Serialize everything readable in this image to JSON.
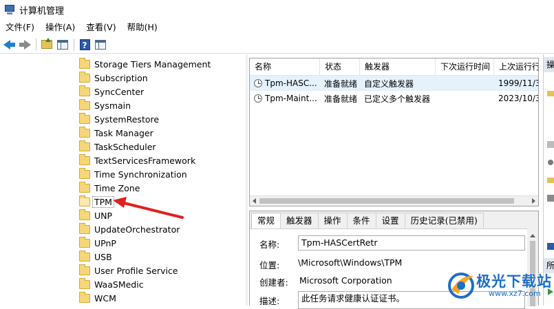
{
  "window": {
    "title": "计算机管理"
  },
  "menu": [
    "文件(F)",
    "操作(A)",
    "查看(V)",
    "帮助(H)"
  ],
  "toolbar": {
    "icons": [
      "back-arrow-icon",
      "forward-arrow-icon",
      "up-folder-icon",
      "show-hide-tree-icon",
      "help-icon",
      "action-pane-icon"
    ]
  },
  "tree": {
    "items": [
      {
        "label": "Storage Tiers Management"
      },
      {
        "label": "Subscription"
      },
      {
        "label": "SyncCenter"
      },
      {
        "label": "Sysmain"
      },
      {
        "label": "SystemRestore"
      },
      {
        "label": "Task Manager"
      },
      {
        "label": "TaskScheduler"
      },
      {
        "label": "TextServicesFramework"
      },
      {
        "label": "Time Synchronization"
      },
      {
        "label": "Time Zone"
      },
      {
        "label": "TPM",
        "selected": true
      },
      {
        "label": "UNP"
      },
      {
        "label": "UpdateOrchestrator"
      },
      {
        "label": "UPnP"
      },
      {
        "label": "USB"
      },
      {
        "label": "User Profile Service"
      },
      {
        "label": "WaaSMedic"
      },
      {
        "label": "WCM"
      }
    ]
  },
  "task_list": {
    "columns": [
      "名称",
      "状态",
      "触发器",
      "下次运行时间",
      "上次运行行"
    ],
    "rows": [
      {
        "name": "Tpm-HASC...",
        "status": "准备就绪",
        "trigger": "自定义触发器",
        "next_run": "",
        "last_run": "1999/11/3"
      },
      {
        "name": "Tpm-Maint...",
        "status": "准备就绪",
        "trigger": "已定义多个触发器",
        "next_run": "",
        "last_run": "2023/10/3"
      }
    ]
  },
  "detail": {
    "tabs": [
      "常规",
      "触发器",
      "操作",
      "条件",
      "设置",
      "历史记录(已禁用)"
    ],
    "name_label": "名称:",
    "name_value": "Tpm-HASCertRetr",
    "location_label": "位置:",
    "location_value": "\\Microsoft\\Windows\\TPM",
    "author_label": "创建者:",
    "author_value": "Microsoft Corporation",
    "description_label": "描述:",
    "description_value": "此任务请求健康认证证书。"
  },
  "actions_pane": {
    "header_top": "操",
    "header_bottom": "所"
  },
  "watermark": {
    "text": "极光下载站",
    "url": "www.xz7.com"
  },
  "colors": {
    "accent": "#1e7fd0",
    "selection": "#e5f1fb",
    "annotation_arrow": "#e02020"
  }
}
